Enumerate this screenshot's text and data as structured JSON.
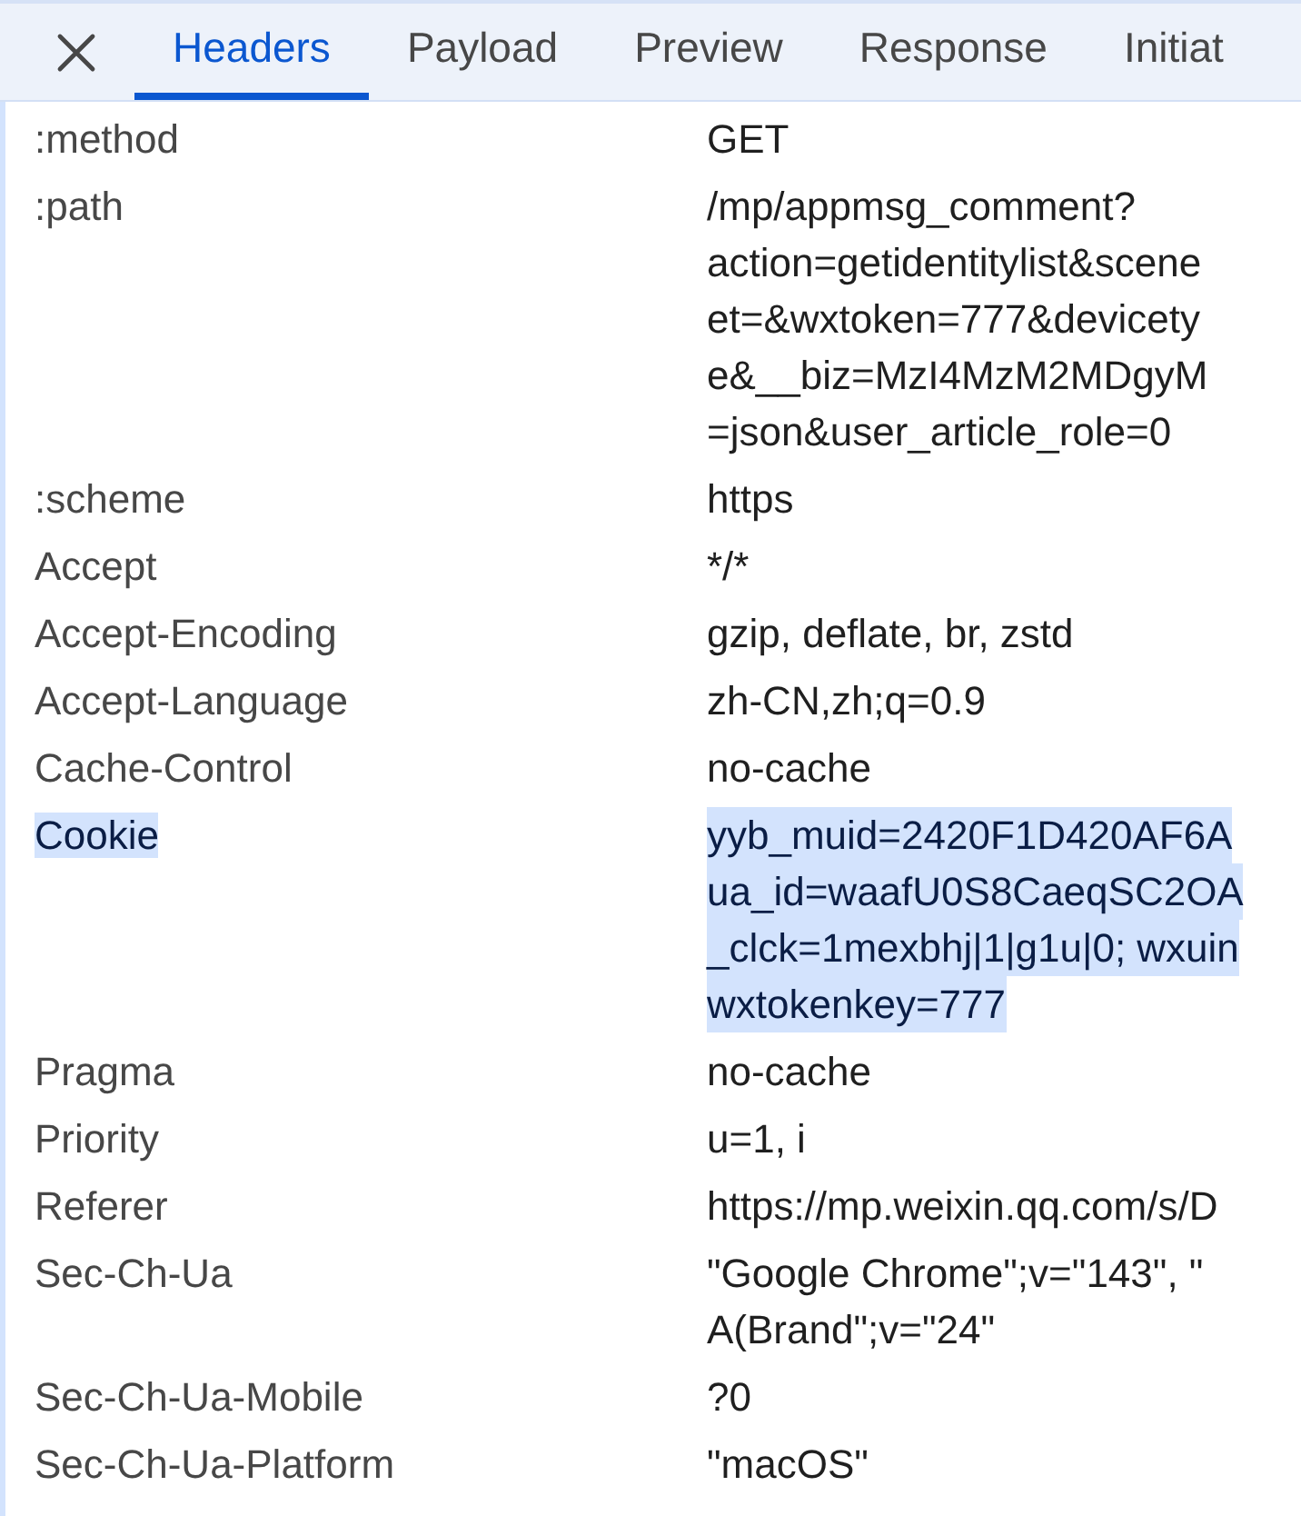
{
  "tabs": [
    {
      "label": "Headers",
      "selected": true
    },
    {
      "label": "Payload",
      "selected": false
    },
    {
      "label": "Preview",
      "selected": false
    },
    {
      "label": "Response",
      "selected": false
    },
    {
      "label": "Initiat",
      "selected": false
    }
  ],
  "headers": [
    {
      "name": ":method",
      "value_lines": [
        "GET"
      ],
      "highlighted": false
    },
    {
      "name": ":path",
      "value_lines": [
        "/mp/appmsg_comment?",
        "action=getidentitylist&scene",
        "et=&wxtoken=777&devicety",
        "e&__biz=MzI4MzM2MDgyM",
        "=json&user_article_role=0"
      ],
      "highlighted": false
    },
    {
      "name": ":scheme",
      "value_lines": [
        "https"
      ],
      "highlighted": false
    },
    {
      "name": "Accept",
      "value_lines": [
        "*/*"
      ],
      "highlighted": false
    },
    {
      "name": "Accept-Encoding",
      "value_lines": [
        "gzip, deflate, br, zstd"
      ],
      "highlighted": false
    },
    {
      "name": "Accept-Language",
      "value_lines": [
        "zh-CN,zh;q=0.9"
      ],
      "highlighted": false
    },
    {
      "name": "Cache-Control",
      "value_lines": [
        "no-cache"
      ],
      "highlighted": false
    },
    {
      "name": "Cookie",
      "value_lines": [
        "yyb_muid=2420F1D420AF6A",
        "ua_id=waafU0S8CaeqSC2OA",
        "_clck=1mexbhj|1|g1u|0; wxuin",
        "wxtokenkey=777"
      ],
      "highlighted": true
    },
    {
      "name": "Pragma",
      "value_lines": [
        "no-cache"
      ],
      "highlighted": false
    },
    {
      "name": "Priority",
      "value_lines": [
        "u=1, i"
      ],
      "highlighted": false
    },
    {
      "name": "Referer",
      "value_lines": [
        "https://mp.weixin.qq.com/s/D"
      ],
      "highlighted": false
    },
    {
      "name": "Sec-Ch-Ua",
      "value_lines": [
        "\"Google Chrome\";v=\"143\", \"",
        "A(Brand\";v=\"24\""
      ],
      "highlighted": false
    },
    {
      "name": "Sec-Ch-Ua-Mobile",
      "value_lines": [
        "?0"
      ],
      "highlighted": false
    },
    {
      "name": "Sec-Ch-Ua-Platform",
      "value_lines": [
        "\"macOS\""
      ],
      "highlighted": false
    }
  ]
}
